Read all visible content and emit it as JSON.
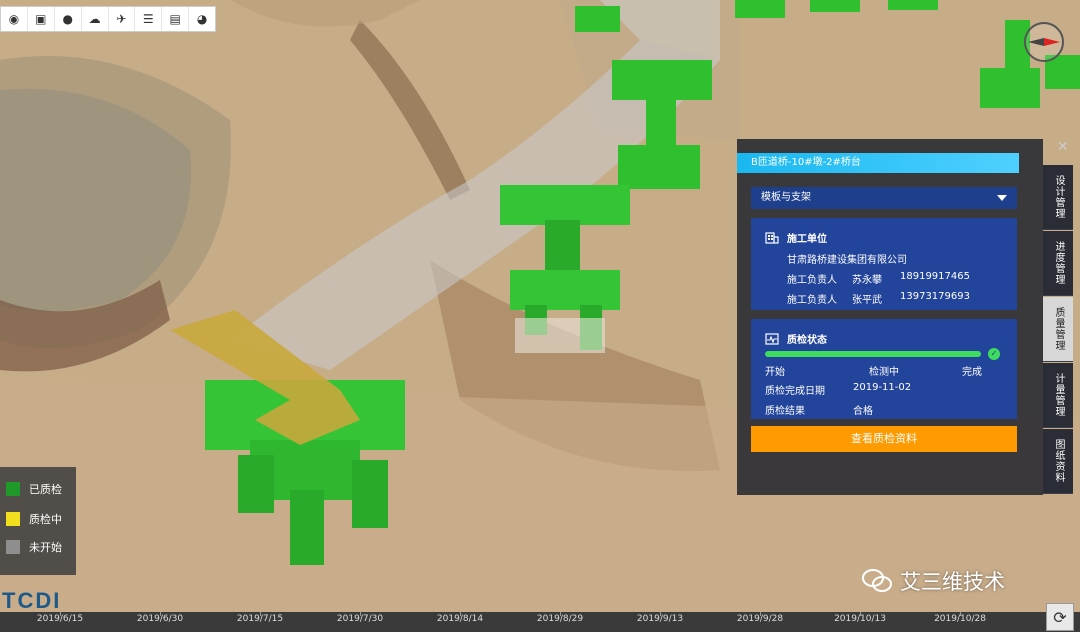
{
  "toolbar": {
    "tools": [
      {
        "name": "eye-icon",
        "glyph": "◉"
      },
      {
        "name": "image-icon",
        "glyph": "▣"
      },
      {
        "name": "globe-dot-icon",
        "glyph": "●"
      },
      {
        "name": "cloud-icon",
        "glyph": "☁"
      },
      {
        "name": "pin-icon",
        "glyph": "✈"
      },
      {
        "name": "list-icon",
        "glyph": "☰"
      },
      {
        "name": "grid-list-icon",
        "glyph": "▤"
      },
      {
        "name": "globe-icon",
        "glyph": "◕"
      }
    ]
  },
  "legend": {
    "items": [
      {
        "label": "已质检",
        "color": "#1f9a2a"
      },
      {
        "label": "质检中",
        "color": "#f2e01e"
      },
      {
        "label": "未开始",
        "color": "#8e8e8e"
      }
    ]
  },
  "logo": {
    "text": "TCDI"
  },
  "watermark": {
    "text": "艾三维技术"
  },
  "timeline": {
    "dates": [
      "2019/6/15",
      "2019/6/30",
      "2019/7/15",
      "2019/7/30",
      "2019/8/14",
      "2019/8/29",
      "2019/9/13",
      "2019/9/28",
      "2019/10/13",
      "2019/10/28"
    ]
  },
  "panel": {
    "title": "B匝道桥-10#墩-2#桥台",
    "dropdown": "模板与支架",
    "construction": {
      "heading": "施工单位",
      "company": "甘肃路桥建设集团有限公司",
      "rows": [
        {
          "label": "施工负责人",
          "name": "苏永攀",
          "phone": "18919917465"
        },
        {
          "label": "施工负责人",
          "name": "张平武",
          "phone": "13973179693"
        }
      ]
    },
    "quality": {
      "heading": "质检状态",
      "progress_percent": 100,
      "steps": [
        "开始",
        "检测中",
        "完成"
      ],
      "date_label": "质检完成日期",
      "date_value": "2019-11-02",
      "result_label": "质检结果",
      "result_value": "合格"
    },
    "button": "查看质检资料"
  },
  "side_tabs": [
    {
      "label": "设计管理",
      "active": false
    },
    {
      "label": "进度管理",
      "active": false
    },
    {
      "label": "质量管理",
      "active": true
    },
    {
      "label": "计量管理",
      "active": false
    },
    {
      "label": "图纸资料",
      "active": false
    }
  ]
}
